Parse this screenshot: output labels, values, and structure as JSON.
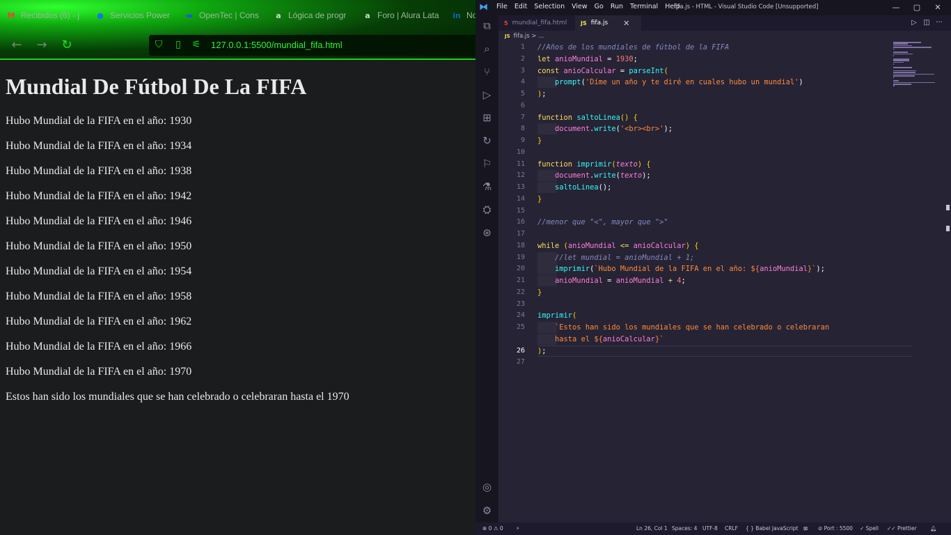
{
  "browser": {
    "tabs": [
      {
        "icon": "gmail-icon",
        "icon_glyph": "M",
        "icon_color": "#ea4335",
        "label": "Recibidos (6) - j"
      },
      {
        "icon": "powerbi-icon",
        "icon_glyph": "●",
        "icon_color": "#1a73e8",
        "label": "Servicios Power"
      },
      {
        "icon": "opentec-icon",
        "icon_glyph": "▬",
        "icon_color": "#1e5bd8",
        "label": "OpenTec | Cons"
      },
      {
        "icon": "alura-icon",
        "icon_glyph": "a",
        "icon_color": "#cfd8cf",
        "label": "Lógica de progr"
      },
      {
        "icon": "alura-icon",
        "icon_glyph": "a",
        "icon_color": "#cfd8cf",
        "label": "Foro | Alura Lata"
      },
      {
        "icon": "linkedin-icon",
        "icon_glyph": "in",
        "icon_color": "#0a66c2",
        "label": "No"
      }
    ],
    "url": "127.0.0.1:5500/mundial_fifa.html"
  },
  "page": {
    "title": "Mundial De Fútbol De La FIFA",
    "lines": [
      "Hubo Mundial de la FIFA en el año: 1930",
      "Hubo Mundial de la FIFA en el año: 1934",
      "Hubo Mundial de la FIFA en el año: 1938",
      "Hubo Mundial de la FIFA en el año: 1942",
      "Hubo Mundial de la FIFA en el año: 1946",
      "Hubo Mundial de la FIFA en el año: 1950",
      "Hubo Mundial de la FIFA en el año: 1954",
      "Hubo Mundial de la FIFA en el año: 1958",
      "Hubo Mundial de la FIFA en el año: 1962",
      "Hubo Mundial de la FIFA en el año: 1966",
      "Hubo Mundial de la FIFA en el año: 1970"
    ],
    "closing": "Estos han sido los mundiales que se han celebrado o celebraran hasta el 1970"
  },
  "vscode": {
    "menus": [
      "File",
      "Edit",
      "Selection",
      "View",
      "Go",
      "Run",
      "Terminal",
      "Help"
    ],
    "window_title": "fifa.js - HTML - Visual Studio Code [Unsupported]",
    "tabs": [
      {
        "icon": "html-file-icon",
        "glyph": "5",
        "color": "#e44d26",
        "label": "mundial_fifa.html",
        "active": false
      },
      {
        "icon": "js-file-icon",
        "glyph": "JS",
        "color": "#f1e05a",
        "label": "fifa.js",
        "active": true
      }
    ],
    "breadcrumb": {
      "icon": "JS",
      "text": "fifa.js > ..."
    },
    "line_numbers": [
      "1",
      "2",
      "3",
      "4",
      "5",
      "6",
      "7",
      "8",
      "9",
      "10",
      "11",
      "12",
      "13",
      "14",
      "15",
      "16",
      "17",
      "18",
      "19",
      "20",
      "21",
      "22",
      "23",
      "24",
      "25",
      "",
      "26",
      "27"
    ],
    "current_line": "26",
    "status": {
      "errors": "⊗ 0 ⚠ 0",
      "position": "Ln 26, Col 1",
      "spaces": "Spaces: 4",
      "encoding": "UTF-8",
      "eol": "CRLF",
      "language": "{ } Babel JavaScript",
      "port": "⊘ Port : 5500",
      "spell": "✓ Spell",
      "prettier": "✓✓ Prettier"
    }
  },
  "code": [
    [
      [
        "cmt",
        "//Años de los mundiales de fútbol de la FIFA"
      ]
    ],
    [
      [
        "kw",
        "let "
      ],
      [
        "var",
        "anioMundial"
      ],
      [
        "pun",
        " = "
      ],
      [
        "num",
        "1930"
      ],
      [
        "pun",
        ";"
      ]
    ],
    [
      [
        "kw",
        "const "
      ],
      [
        "var",
        "anioCalcular"
      ],
      [
        "pun",
        " = "
      ],
      [
        "fn",
        "parseInt"
      ],
      [
        "par",
        "("
      ]
    ],
    [
      [
        "ind",
        ""
      ],
      [
        "fn",
        "prompt"
      ],
      [
        "pun",
        "("
      ],
      [
        "str",
        "'Díme un año y te diré en cuales hubo un mundial'"
      ],
      [
        "pun",
        ")"
      ]
    ],
    [
      [
        "par",
        ")"
      ],
      [
        "pun",
        ";"
      ]
    ],
    [],
    [
      [
        "kw",
        "function "
      ],
      [
        "fn",
        "saltoLinea"
      ],
      [
        "par",
        "() {"
      ]
    ],
    [
      [
        "ind",
        ""
      ],
      [
        "var",
        "document"
      ],
      [
        "pun",
        "."
      ],
      [
        "fn",
        "write"
      ],
      [
        "pun",
        "("
      ],
      [
        "str",
        "'<br><br>'"
      ],
      [
        "pun",
        ");"
      ]
    ],
    [
      [
        "par",
        "}"
      ]
    ],
    [],
    [
      [
        "kw",
        "function "
      ],
      [
        "fn",
        "imprimir"
      ],
      [
        "par",
        "("
      ],
      [
        "ital",
        "texto"
      ],
      [
        "par",
        ") {"
      ]
    ],
    [
      [
        "ind",
        ""
      ],
      [
        "var",
        "document"
      ],
      [
        "pun",
        "."
      ],
      [
        "fn",
        "write"
      ],
      [
        "pun",
        "("
      ],
      [
        "ital",
        "texto"
      ],
      [
        "pun",
        ");"
      ]
    ],
    [
      [
        "ind",
        ""
      ],
      [
        "fn",
        "saltoLinea"
      ],
      [
        "pun",
        "();"
      ]
    ],
    [
      [
        "par",
        "}"
      ]
    ],
    [],
    [
      [
        "cmt",
        "//menor que \"<\", mayor que \">\""
      ]
    ],
    [],
    [
      [
        "kw",
        "while "
      ],
      [
        "par",
        "("
      ],
      [
        "var",
        "anioMundial"
      ],
      [
        "kw",
        " <= "
      ],
      [
        "var",
        "anioCalcular"
      ],
      [
        "par",
        ") {"
      ]
    ],
    [
      [
        "ind",
        ""
      ],
      [
        "cmt",
        "//let mundial = anioMundial + 1;"
      ]
    ],
    [
      [
        "ind",
        ""
      ],
      [
        "fn",
        "imprimir"
      ],
      [
        "pun",
        "("
      ],
      [
        "str",
        "`Hubo Mundial de la FIFA en el año: ${"
      ],
      [
        "var",
        "anioMundial"
      ],
      [
        "str",
        "}`"
      ],
      [
        "pun",
        ");"
      ]
    ],
    [
      [
        "ind",
        ""
      ],
      [
        "var",
        "anioMundial"
      ],
      [
        "pun",
        " = "
      ],
      [
        "var",
        "anioMundial"
      ],
      [
        "kw",
        " + "
      ],
      [
        "num",
        "4"
      ],
      [
        "pun",
        ";"
      ]
    ],
    [
      [
        "par",
        "}"
      ]
    ],
    [],
    [
      [
        "fn",
        "imprimir"
      ],
      [
        "par",
        "("
      ]
    ],
    [
      [
        "ind",
        ""
      ],
      [
        "str",
        "`Estos han sido los mundiales que se han celebrado o celebraran"
      ]
    ],
    [
      [
        "ind",
        ""
      ],
      [
        "str",
        "hasta el ${"
      ],
      [
        "var",
        "anioCalcular"
      ],
      [
        "str",
        "}`"
      ]
    ],
    [
      [
        "par",
        ")"
      ],
      [
        "pun",
        ";"
      ]
    ],
    []
  ],
  "colors": {
    "browser_accent": "#35f235",
    "editor_bg": "#262335",
    "keyword": "#fede5d",
    "variable": "#ff7edb",
    "function": "#36f9f6",
    "string": "#ff8b39",
    "number": "#f97e72",
    "comment": "#848bbd"
  }
}
